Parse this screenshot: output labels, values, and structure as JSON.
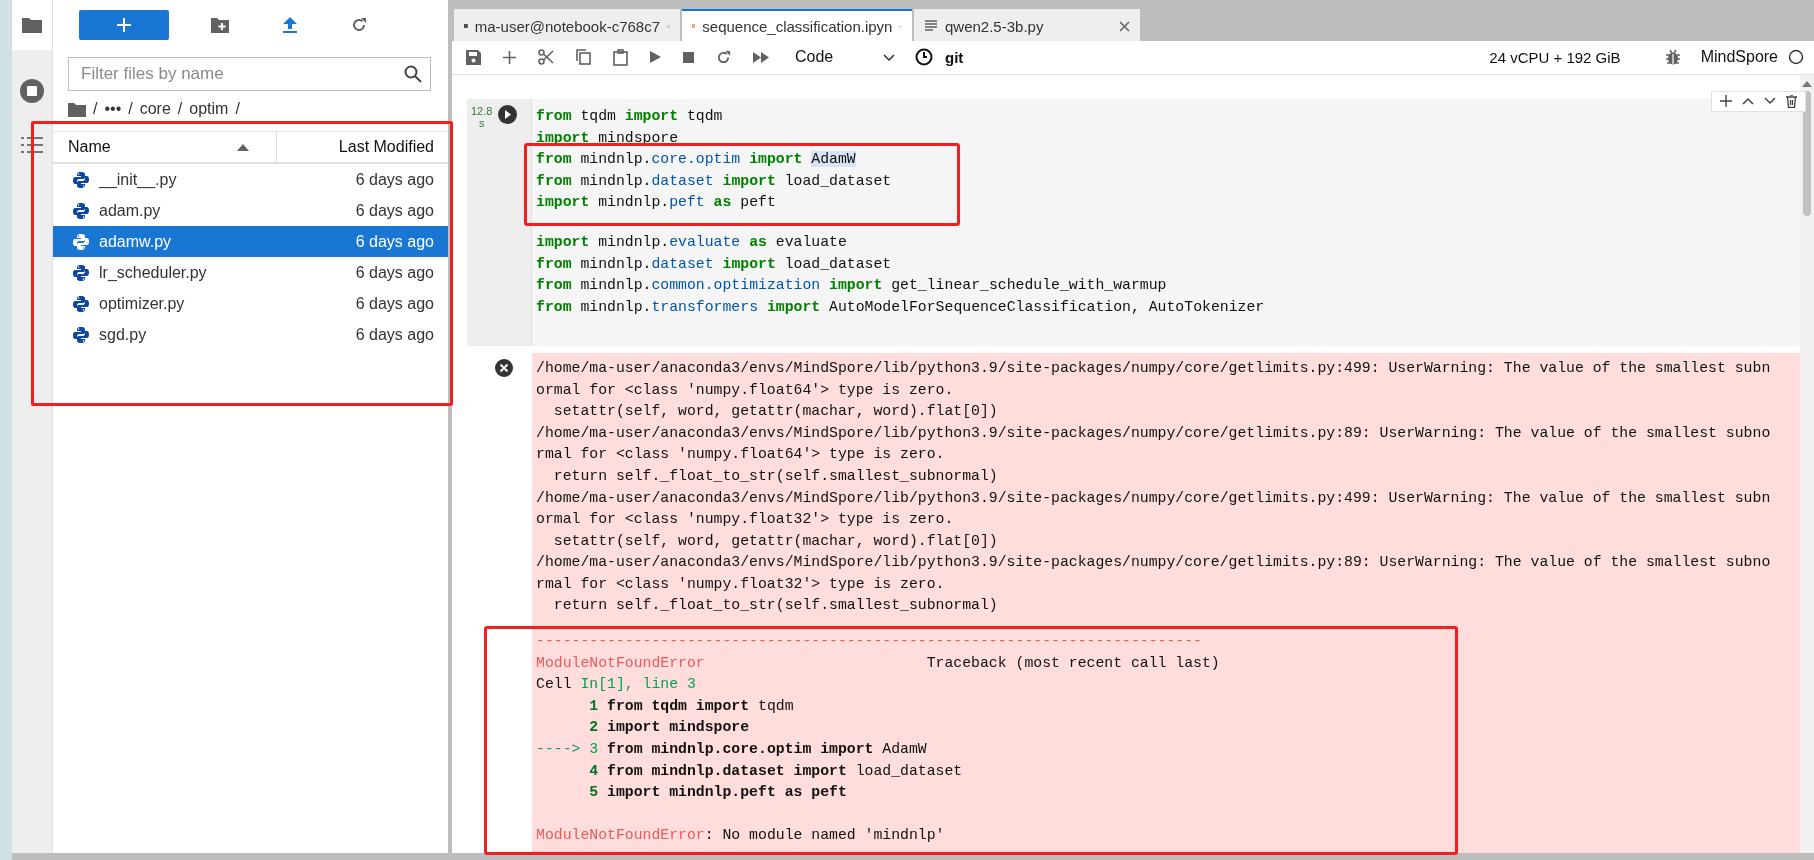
{
  "file_browser": {
    "search": {
      "placeholder": "Filter files by name"
    },
    "breadcrumb": [
      "/",
      "•••",
      "/",
      "core",
      "/",
      "optim",
      "/"
    ],
    "columns": [
      {
        "label": "Name",
        "sorted": true
      },
      {
        "label": "Last Modified",
        "sorted": false
      }
    ],
    "highlighted": true,
    "files": [
      {
        "name": "__init__.py",
        "modified": "6 days ago",
        "selected": false
      },
      {
        "name": "adam.py",
        "modified": "6 days ago",
        "selected": false
      },
      {
        "name": "adamw.py",
        "modified": "6 days ago",
        "selected": true
      },
      {
        "name": "lr_scheduler.py",
        "modified": "6 days ago",
        "selected": false
      },
      {
        "name": "optimizer.py",
        "modified": "6 days ago",
        "selected": false
      },
      {
        "name": "sgd.py",
        "modified": "6 days ago",
        "selected": false
      }
    ]
  },
  "tabs": [
    {
      "label": "ma-user@notebook-c768c7",
      "kind": "terminal",
      "selected": false
    },
    {
      "label": "sequence_classification.ipyn",
      "kind": "notebook",
      "selected": true
    },
    {
      "label": "qwen2.5-3b.py",
      "kind": "text",
      "selected": false
    }
  ],
  "toolbar": {
    "cell_type": "Code",
    "git": "git",
    "resources": "24 vCPU + 192 GiB",
    "kernel": "MindSpore",
    "kernel_busy": false
  },
  "cell": {
    "exec_time": {
      "value": "12.8",
      "unit": "s"
    },
    "code_blocks": [
      {
        "highlighted": false,
        "lines": [
          [
            {
              "text": "from",
              "kind": "kw"
            },
            {
              "text": " tqdm ",
              "kind": "plain"
            },
            {
              "text": "import",
              "kind": "kw"
            },
            {
              "text": " tqdm",
              "kind": "plain"
            }
          ],
          [
            {
              "text": "import",
              "kind": "kw"
            },
            {
              "text": " mindspore",
              "kind": "plain"
            }
          ]
        ]
      },
      {
        "highlighted": true,
        "lines": [
          [
            {
              "text": "from",
              "kind": "kw"
            },
            {
              "text": " mindnlp.",
              "kind": "plain"
            },
            {
              "text": "core.optim",
              "kind": "attr"
            },
            {
              "text": " import ",
              "kind": "kw"
            },
            {
              "text": "AdamW",
              "kind": "match"
            }
          ],
          [
            {
              "text": "from",
              "kind": "kw"
            },
            {
              "text": " mindnlp.",
              "kind": "plain"
            },
            {
              "text": "dataset",
              "kind": "attr"
            },
            {
              "text": " import",
              "kind": "kw"
            },
            {
              "text": " load_dataset",
              "kind": "plain"
            }
          ],
          [
            {
              "text": "import",
              "kind": "kw"
            },
            {
              "text": " mindnlp.",
              "kind": "plain"
            },
            {
              "text": "peft",
              "kind": "attr"
            },
            {
              "text": " as",
              "kind": "kw"
            },
            {
              "text": " peft",
              "kind": "plain"
            }
          ]
        ]
      },
      {
        "highlighted": false,
        "lines": [
          [
            {
              "text": "import",
              "kind": "kw"
            },
            {
              "text": " mindnlp.",
              "kind": "plain"
            },
            {
              "text": "evaluate",
              "kind": "attr"
            },
            {
              "text": " as",
              "kind": "kw"
            },
            {
              "text": " evaluate",
              "kind": "plain"
            }
          ],
          [
            {
              "text": "from",
              "kind": "kw"
            },
            {
              "text": " mindnlp.",
              "kind": "plain"
            },
            {
              "text": "dataset",
              "kind": "attr"
            },
            {
              "text": " import",
              "kind": "kw"
            },
            {
              "text": " load_dataset",
              "kind": "plain"
            }
          ],
          [
            {
              "text": "from",
              "kind": "kw"
            },
            {
              "text": " mindnlp.",
              "kind": "plain"
            },
            {
              "text": "common.optimization",
              "kind": "attr"
            },
            {
              "text": " import",
              "kind": "kw"
            },
            {
              "text": " get_linear_schedule_with_warmup",
              "kind": "plain"
            }
          ],
          [
            {
              "text": "from",
              "kind": "kw"
            },
            {
              "text": " mindnlp.",
              "kind": "plain"
            },
            {
              "text": "transformers",
              "kind": "attr"
            },
            {
              "text": " import",
              "kind": "kw"
            },
            {
              "text": " AutoModelForSequenceClassification, AutoTokenizer",
              "kind": "plain"
            }
          ]
        ]
      }
    ]
  },
  "output": {
    "warning_lines": [
      "/home/ma-user/anaconda3/envs/MindSpore/lib/python3.9/site-packages/numpy/core/getlimits.py:499: UserWarning: The value of the smallest subn",
      "ormal for <class 'numpy.float64'> type is zero.",
      "  setattr(self, word, getattr(machar, word).flat[0])",
      "/home/ma-user/anaconda3/envs/MindSpore/lib/python3.9/site-packages/numpy/core/getlimits.py:89: UserWarning: The value of the smallest subno",
      "rmal for <class 'numpy.float64'> type is zero.",
      "  return self._float_to_str(self.smallest_subnormal)",
      "/home/ma-user/anaconda3/envs/MindSpore/lib/python3.9/site-packages/numpy/core/getlimits.py:499: UserWarning: The value of the smallest subn",
      "ormal for <class 'numpy.float32'> type is zero.",
      "  setattr(self, word, getattr(machar, word).flat[0])",
      "/home/ma-user/anaconda3/envs/MindSpore/lib/python3.9/site-packages/numpy/core/getlimits.py:89: UserWarning: The value of the smallest subno",
      "rmal for <class 'numpy.float32'> type is zero.",
      "  return self._float_to_str(self.smallest_subnormal)"
    ],
    "traceback": {
      "highlighted": true,
      "lines": [
        [
          {
            "text": "---------------------------------------------------------------------------",
            "kind": "err"
          }
        ],
        [
          {
            "text": "ModuleNotFoundError",
            "kind": "err"
          },
          {
            "text": "                         Traceback (most recent call last)",
            "kind": "plain"
          }
        ],
        [
          {
            "text": "Cell ",
            "kind": "plain"
          },
          {
            "text": "In[1], line 3",
            "kind": "green"
          }
        ],
        [
          {
            "text": "      1",
            "kind": "lineno"
          },
          {
            "text": " from tqdm import",
            "kind": "bold"
          },
          {
            "text": " tqdm",
            "kind": "plain"
          }
        ],
        [
          {
            "text": "      2",
            "kind": "lineno"
          },
          {
            "text": " import mindspore",
            "kind": "bold"
          }
        ],
        [
          {
            "text": "----> 3",
            "kind": "green"
          },
          {
            "text": " from mindnlp.core.optim import",
            "kind": "bold"
          },
          {
            "text": " AdamW",
            "kind": "plain"
          }
        ],
        [
          {
            "text": "      4",
            "kind": "lineno"
          },
          {
            "text": " from mindnlp.dataset import",
            "kind": "bold"
          },
          {
            "text": " load_dataset",
            "kind": "plain"
          }
        ],
        [
          {
            "text": "      5",
            "kind": "lineno"
          },
          {
            "text": " import mindnlp.peft as peft",
            "kind": "bold"
          }
        ],
        [
          {
            "text": "ModuleNotFoundError",
            "kind": "err"
          },
          {
            "text": ": No module named 'mindnlp'",
            "kind": "plain"
          }
        ]
      ]
    }
  }
}
